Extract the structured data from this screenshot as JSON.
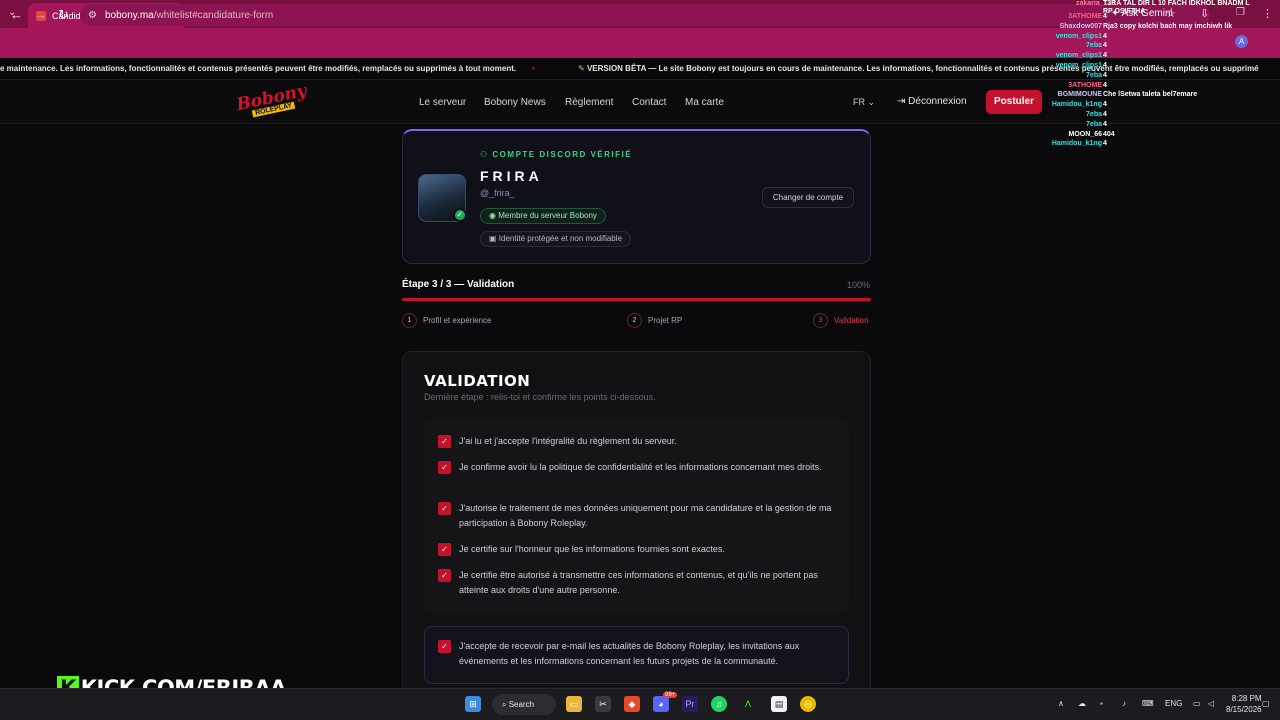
{
  "browser": {
    "tab_title": "Candidature Whitelist - Bobony",
    "tab_close": "×",
    "new_tab": "+",
    "tabs_menu": "⌄",
    "url_host": "bobony.ma",
    "url_path": "/whitelist#candidature-form",
    "ask_gemini": "Ask Gemini",
    "profile_initial": "A",
    "icons": [
      "back-icon",
      "forward-icon",
      "reload-icon",
      "star-icon",
      "menu-icon"
    ]
  },
  "ticker": {
    "segment_1": "e maintenance. Les informations, fonctionnalités et contenus présentés peuvent être modifiés, remplacés ou supprimés à tout moment.",
    "separator": "•",
    "segment_2": "VERSION BÊTA — Le site Bobony est toujours en cours de maintenance. Les informations, fonctionnalités et contenus présentés peuvent être modifiés, remplacés ou supprimé"
  },
  "site_nav": {
    "logo_main": "Bobony",
    "logo_sub": "ROLEPLAY",
    "links": [
      "Le serveur",
      "Bobony News",
      "Règlement",
      "Contact",
      "Ma carte"
    ],
    "lang": "FR",
    "logout": "Déconnexion",
    "apply": "Postuler"
  },
  "discord_card": {
    "verified_label": "COMPTE DISCORD VÉRIFIÉ",
    "username": "FRIRA",
    "handle": "@_frira_",
    "member_badge": "Membre du serveur Bobony",
    "identity_badge": "Identité protégée et non modifiable",
    "change_account": "Changer de compte"
  },
  "progress": {
    "title": "Étape 3 / 3 — Validation",
    "percent_label": "100%",
    "fraction": 1.0,
    "steps": [
      {
        "num": "1",
        "label": "Profil et expérience"
      },
      {
        "num": "2",
        "label": "Projet RP"
      },
      {
        "num": "3",
        "label": "Validation"
      }
    ]
  },
  "validation": {
    "title": "VALIDATION",
    "subtitle": "Dernière étape : relis-toi et confirme les points ci-dessous.",
    "items": [
      "J'ai lu et j'accepte l'intégralité du règlement du serveur.",
      "Je confirme avoir lu la politique de confidentialité et les informations concernant mes droits.",
      "J'autorise le traitement de mes données uniquement pour ma candidature et la gestion de ma participation à Bobony Roleplay.",
      "Je certifie sur l'honneur que les informations fournies sont exactes.",
      "Je certifie être autorisé à transmettre ces informations et contenus, et qu'ils ne portent pas atteinte aux droits d'une autre personne."
    ],
    "optin": "J'accepte de recevoir par e-mail les actualités de Bobony Roleplay, les invitations aux événements et les informations concernant les futurs projets de la communauté.",
    "check_glyph": "✓"
  },
  "chat": [
    {
      "name": "3ATHOME",
      "msg": "4",
      "color": "#ff5e8a"
    },
    {
      "name": "Shaxdow007",
      "msg": "Rja3 copy kolchi bach may imchiwh lik",
      "color": "#c8c8ff"
    },
    {
      "name": "venom_clips1",
      "msg": "4",
      "color": "#39e0e0"
    },
    {
      "name": "7eba",
      "msg": "4",
      "color": "#39e0e0"
    },
    {
      "name": "venom_clips1",
      "msg": "4",
      "color": "#39e0e0"
    },
    {
      "name": "venom_clips1",
      "msg": "4",
      "color": "#39e0e0"
    },
    {
      "name": "7eba",
      "msg": "4",
      "color": "#39e0e0"
    },
    {
      "name": "3ATHOME",
      "msg": "4",
      "color": "#ff5e8a"
    },
    {
      "name": "BGMIMOUNE",
      "msg": "Che lSetwa taleta bel7emare",
      "color": "#c8c8ff"
    },
    {
      "name": "Hamidou_k1ng",
      "msg": "4",
      "color": "#39e0e0"
    },
    {
      "name": "7eba",
      "msg": "4",
      "color": "#39e0e0"
    },
    {
      "name": "7eba",
      "msg": "4",
      "color": "#39e0e0"
    },
    {
      "name": "MOON_66",
      "msg": "404",
      "color": "#ffffff"
    },
    {
      "name": "Hamidou_k1ng",
      "msg": "4",
      "color": "#39e0e0"
    }
  ],
  "chat_header": {
    "name": "zakaria_123",
    "msg": "T3RA TAL DIR L 10 FACH IDKHOL BNADM L RP OSIFTHA"
  },
  "stream": {
    "kick_prefix": "K",
    "kick_text": "KICK.COM/FRIRAA"
  },
  "taskbar": {
    "search": "Search",
    "lang": "ENG",
    "time": "8:28 PM",
    "date": "8/15/2026",
    "badge": "99+"
  },
  "colors": {
    "accent": "#c4122e",
    "verified": "#37d28a",
    "brand_chrome": "#a3175a"
  }
}
